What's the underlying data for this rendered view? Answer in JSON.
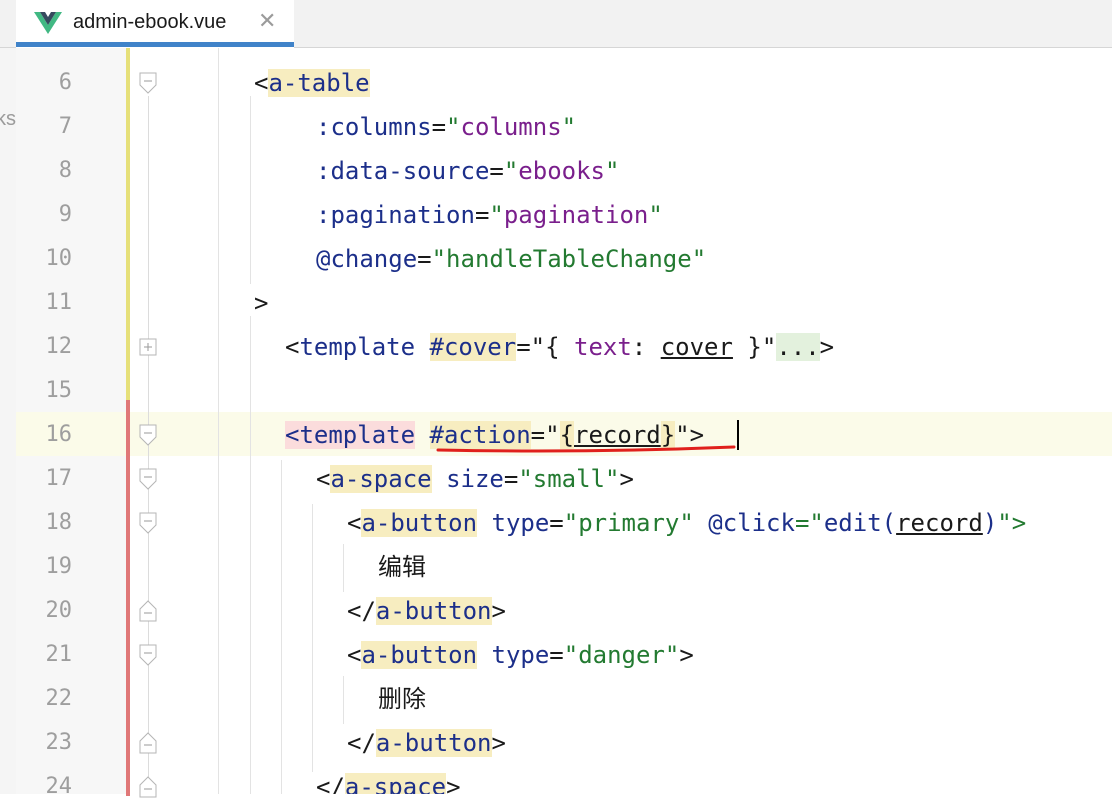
{
  "tab": {
    "title": "admin-ebook.vue",
    "close_glyph": "✕",
    "icon": "vue-logo-icon"
  },
  "left_edge_text": "ks",
  "colors": {
    "tag": "#1c2f8a",
    "string": "#237a31",
    "string_value": "#7a1f8c",
    "tag_highlight": "#f7edc0",
    "error_highlight": "#fbdcdc",
    "tab_accent": "#4083c9"
  },
  "lines": [
    {
      "num": "6",
      "segments": [
        {
          "t": "<",
          "c": "punct"
        },
        {
          "t": "a-table",
          "c": "tag hl"
        }
      ]
    },
    {
      "num": "7",
      "segments": [
        {
          "t": ":columns",
          "c": "attr"
        },
        {
          "t": "=",
          "c": "punct"
        },
        {
          "t": "\"",
          "c": "str"
        },
        {
          "t": "columns",
          "c": "strv"
        },
        {
          "t": "\"",
          "c": "str"
        }
      ]
    },
    {
      "num": "8",
      "segments": [
        {
          "t": ":data-source",
          "c": "attr"
        },
        {
          "t": "=",
          "c": "punct"
        },
        {
          "t": "\"",
          "c": "str"
        },
        {
          "t": "ebooks",
          "c": "strv"
        },
        {
          "t": "\"",
          "c": "str"
        }
      ]
    },
    {
      "num": "9",
      "segments": [
        {
          "t": ":pagination",
          "c": "attr"
        },
        {
          "t": "=",
          "c": "punct"
        },
        {
          "t": "\"",
          "c": "str"
        },
        {
          "t": "pagination",
          "c": "strv"
        },
        {
          "t": "\"",
          "c": "str"
        }
      ]
    },
    {
      "num": "10",
      "segments": [
        {
          "t": "@change",
          "c": "attr"
        },
        {
          "t": "=",
          "c": "punct"
        },
        {
          "t": "\"handleTableChange\"",
          "c": "str"
        }
      ]
    },
    {
      "num": "11",
      "segments": [
        {
          "t": ">",
          "c": "punct"
        }
      ]
    },
    {
      "num": "12",
      "segments": [
        {
          "t": "<",
          "c": "punct"
        },
        {
          "t": "template",
          "c": "tag"
        },
        {
          "t": " ",
          "c": "punct"
        },
        {
          "t": "#cover",
          "c": "directive hl"
        },
        {
          "t": "=\"{ ",
          "c": "punct"
        },
        {
          "t": "text",
          "c": "strv"
        },
        {
          "t": ": ",
          "c": "punct"
        },
        {
          "t": "cover",
          "c": "punct ul"
        },
        {
          "t": " }\"",
          "c": "punct"
        },
        {
          "t": "...",
          "c": "punct hl-green"
        },
        {
          "t": ">",
          "c": "punct"
        }
      ]
    },
    {
      "num": "15",
      "segments": []
    },
    {
      "num": "16",
      "segments": [
        {
          "t": "<template",
          "c": "tag hl-red"
        },
        {
          "t": " ",
          "c": "punct"
        },
        {
          "t": "#action",
          "c": "directive hl"
        },
        {
          "t": "=\"",
          "c": "punct"
        },
        {
          "t": "{",
          "c": "punct hl"
        },
        {
          "t": "record",
          "c": "punct ul"
        },
        {
          "t": "}",
          "c": "punct hl"
        },
        {
          "t": "\">",
          "c": "punct"
        }
      ]
    },
    {
      "num": "17",
      "segments": [
        {
          "t": "<",
          "c": "punct"
        },
        {
          "t": "a-space",
          "c": "tag hl"
        },
        {
          "t": " ",
          "c": "punct"
        },
        {
          "t": "size",
          "c": "attr"
        },
        {
          "t": "=",
          "c": "punct"
        },
        {
          "t": "\"small\"",
          "c": "str"
        },
        {
          "t": ">",
          "c": "punct"
        }
      ]
    },
    {
      "num": "18",
      "segments": [
        {
          "t": "<",
          "c": "punct"
        },
        {
          "t": "a-button",
          "c": "tag hl"
        },
        {
          "t": " ",
          "c": "punct"
        },
        {
          "t": "type",
          "c": "attr"
        },
        {
          "t": "=",
          "c": "punct"
        },
        {
          "t": "\"primary\"",
          "c": "str"
        },
        {
          "t": " ",
          "c": "punct"
        },
        {
          "t": "@click",
          "c": "attr"
        },
        {
          "t": "=\"",
          "c": "str"
        },
        {
          "t": "edit(",
          "c": "tag"
        },
        {
          "t": "record",
          "c": "punct ul"
        },
        {
          "t": ")",
          "c": "tag"
        },
        {
          "t": "\">",
          "c": "str"
        }
      ]
    },
    {
      "num": "19",
      "segments": [
        {
          "t": "编辑",
          "c": "punct"
        }
      ]
    },
    {
      "num": "20",
      "segments": [
        {
          "t": "</",
          "c": "punct"
        },
        {
          "t": "a-button",
          "c": "tag hl"
        },
        {
          "t": ">",
          "c": "punct"
        }
      ]
    },
    {
      "num": "21",
      "segments": [
        {
          "t": "<",
          "c": "punct"
        },
        {
          "t": "a-button",
          "c": "tag hl"
        },
        {
          "t": " ",
          "c": "punct"
        },
        {
          "t": "type",
          "c": "attr"
        },
        {
          "t": "=",
          "c": "punct"
        },
        {
          "t": "\"danger\"",
          "c": "str"
        },
        {
          "t": ">",
          "c": "punct"
        }
      ]
    },
    {
      "num": "22",
      "segments": [
        {
          "t": "删除",
          "c": "punct"
        }
      ]
    },
    {
      "num": "23",
      "segments": [
        {
          "t": "</",
          "c": "punct"
        },
        {
          "t": "a-button",
          "c": "tag hl"
        },
        {
          "t": ">",
          "c": "punct"
        }
      ]
    },
    {
      "num": "24",
      "segments": [
        {
          "t": "</",
          "c": "punct"
        },
        {
          "t": "a-space",
          "c": "tag hl"
        },
        {
          "t": ">",
          "c": "punct"
        }
      ]
    }
  ]
}
